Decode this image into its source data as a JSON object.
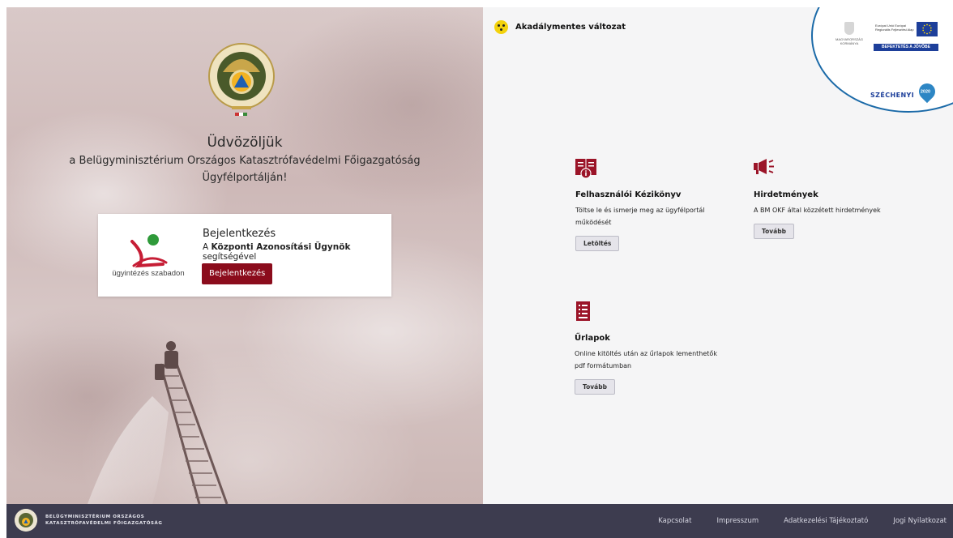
{
  "hero": {
    "emblem_icon": "fire-protection-emblem-icon",
    "welcome_title": "Üdvözöljük",
    "welcome_line1": "a Belügyminisztérium Országos Katasztrófavédelmi Főigazgatóság",
    "welcome_line2": "Ügyfélportálján!"
  },
  "login": {
    "logo_icon": "ugyintezes-szabadon-logo-icon",
    "logo_text": "ügyintézés szabadon",
    "title": "Bejelentkezés",
    "subtitle_prefix": "A ",
    "subtitle_bold": "Központi Azonosítási Ügynök",
    "subtitle_suffix": " segítségével",
    "button": "Bejelentkezés",
    "accent": "#8b0c1c"
  },
  "accessibility": {
    "label": "Akadálymentes változat",
    "icon": "accessibility-braille-icon",
    "color": "#f3d20c"
  },
  "eu_badge": {
    "gov_text": "MAGYARORSZÁG KORMÁNYA",
    "eu_text": "Európai Unió Európai Regionális Fejlesztési Alap",
    "bar_text": "BEFEKTETÉS A JÖVŐBE",
    "szechenyi": "SZÉCHENYI",
    "year": "2020",
    "color": "#1d3f9a"
  },
  "tiles": [
    {
      "icon": "book-info-icon",
      "title": "Felhasználói Kézikönyv",
      "desc": "Töltse le és ismerje meg az ügyfélportál működését",
      "button": "Letöltés"
    },
    {
      "icon": "megaphone-icon",
      "title": "Hirdetmények",
      "desc": "A BM OKF által közzétett hirdetmények",
      "button": "Tovább"
    },
    {
      "icon": "form-document-icon",
      "title": "Űrlapok",
      "desc": "Online kitöltés után az űrlapok lementhetők pdf formátumban",
      "button": "Tovább"
    }
  ],
  "footer": {
    "logo_icon": "ministry-emblem-icon",
    "org_line1": "BELÜGYMINISZTÉRIUM ORSZÁGOS",
    "org_line2": "KATASZTRÓFAVÉDELMI FŐIGAZGATÓSÁG",
    "links": [
      "Kapcsolat",
      "Impresszum",
      "Adatkezelési Tájékoztató",
      "Jogi Nyilatkozat"
    ],
    "bg": "#3d3c4f"
  }
}
